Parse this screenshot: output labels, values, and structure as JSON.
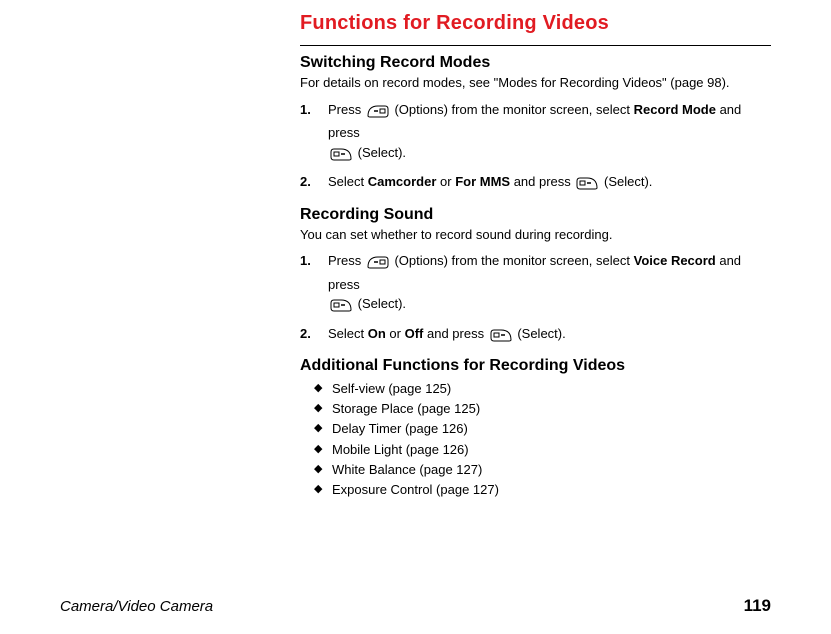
{
  "title": "Functions for Recording Videos",
  "sections": {
    "switching": {
      "heading": "Switching Record Modes",
      "intro": "For details on record modes, see \"Modes for Recording Videos\" (page 98).",
      "step1_a": "Press ",
      "step1_b": " (Options) from the monitor screen, select ",
      "step1_bold1": "Record Mode",
      "step1_c": " and press ",
      "step1_d": " (Select).",
      "step2_a": "Select ",
      "step2_bold1": "Camcorder",
      "step2_b": " or ",
      "step2_bold2": "For MMS",
      "step2_c": " and press ",
      "step2_d": " (Select)."
    },
    "sound": {
      "heading": "Recording Sound",
      "intro": "You can set whether to record sound during recording.",
      "step1_a": "Press ",
      "step1_b": " (Options) from the monitor screen, select ",
      "step1_bold1": "Voice Record",
      "step1_c": " and press ",
      "step1_d": " (Select).",
      "step2_a": "Select ",
      "step2_bold1": "On",
      "step2_b": " or ",
      "step2_bold2": "Off",
      "step2_c": " and press ",
      "step2_d": " (Select)."
    },
    "additional": {
      "heading": "Additional Functions for Recording Videos",
      "items": [
        "Self-view (page 125)",
        "Storage Place (page 125)",
        "Delay Timer (page 126)",
        "Mobile Light (page 126)",
        "White Balance (page 127)",
        "Exposure Control (page 127)"
      ]
    }
  },
  "footer": {
    "section": "Camera/Video Camera",
    "page": "119"
  },
  "icons": {
    "softkey_left": "softkey-left-icon",
    "softkey_right": "softkey-right-icon"
  }
}
